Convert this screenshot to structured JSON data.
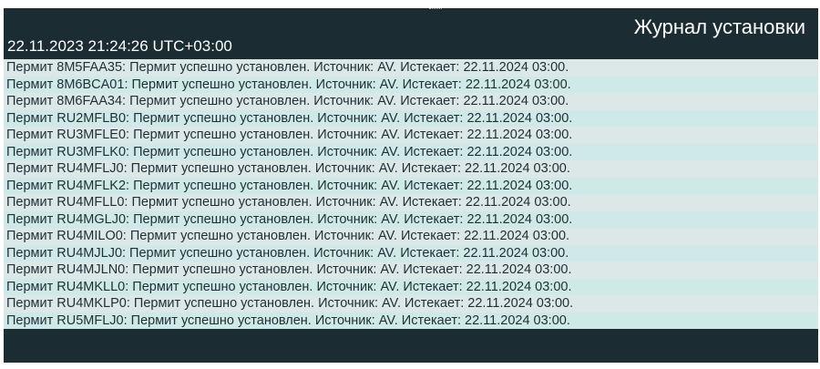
{
  "window": {
    "title": "Журнал установки",
    "timestamp": "22.11.2023 21:24:26 UTC+03:00"
  },
  "log": {
    "entries": [
      "Пермит 8M5FAA35: Пермит успешно установлен. Источник: AV. Истекает: 22.11.2024 03:00.",
      "Пермит 8M6BCA01: Пермит успешно установлен. Источник: AV. Истекает: 22.11.2024 03:00.",
      "Пермит 8M6FAA34: Пермит успешно установлен. Источник: AV. Истекает: 22.11.2024 03:00.",
      "Пермит RU2MFLB0: Пермит успешно установлен. Источник: AV. Истекает: 22.11.2024 03:00.",
      "Пермит RU3MFLE0: Пермит успешно установлен. Источник: AV. Истекает: 22.11.2024 03:00.",
      "Пермит RU3MFLK0: Пермит успешно установлен. Источник: AV. Истекает: 22.11.2024 03:00.",
      "Пермит RU4MFLJ0: Пермит успешно установлен. Источник: AV. Истекает: 22.11.2024 03:00.",
      "Пермит RU4MFLK2: Пермит успешно установлен. Источник: AV. Истекает: 22.11.2024 03:00.",
      "Пермит RU4MFLL0: Пермит успешно установлен. Источник: AV. Истекает: 22.11.2024 03:00.",
      "Пермит RU4MGLJ0: Пермит успешно установлен. Источник: AV. Истекает: 22.11.2024 03:00.",
      "Пермит RU4MILO0: Пермит успешно установлен. Источник: AV. Истекает: 22.11.2024 03:00.",
      "Пермит RU4MJLJ0: Пермит успешно установлен. Источник: AV. Истекает: 22.11.2024 03:00.",
      "Пермит RU4MJLN0: Пермит успешно установлен. Источник: AV. Истекает: 22.11.2024 03:00.",
      "Пермит RU4MKLL0: Пермит успешно установлен. Источник: AV. Истекает: 22.11.2024 03:00.",
      "Пермит RU4MKLP0: Пермит успешно установлен. Источник: AV. Истекает: 22.11.2024 03:00.",
      "Пермит RU5MFLJ0: Пермит успешно установлен. Источник: AV. Истекает: 22.11.2024 03:00."
    ]
  },
  "colors": {
    "panel_background": "#1c2c33",
    "row_odd": "#dce8e8",
    "row_even": "#cfe9e9",
    "text_dark": "#1f2f36",
    "text_light": "#ffffff"
  }
}
